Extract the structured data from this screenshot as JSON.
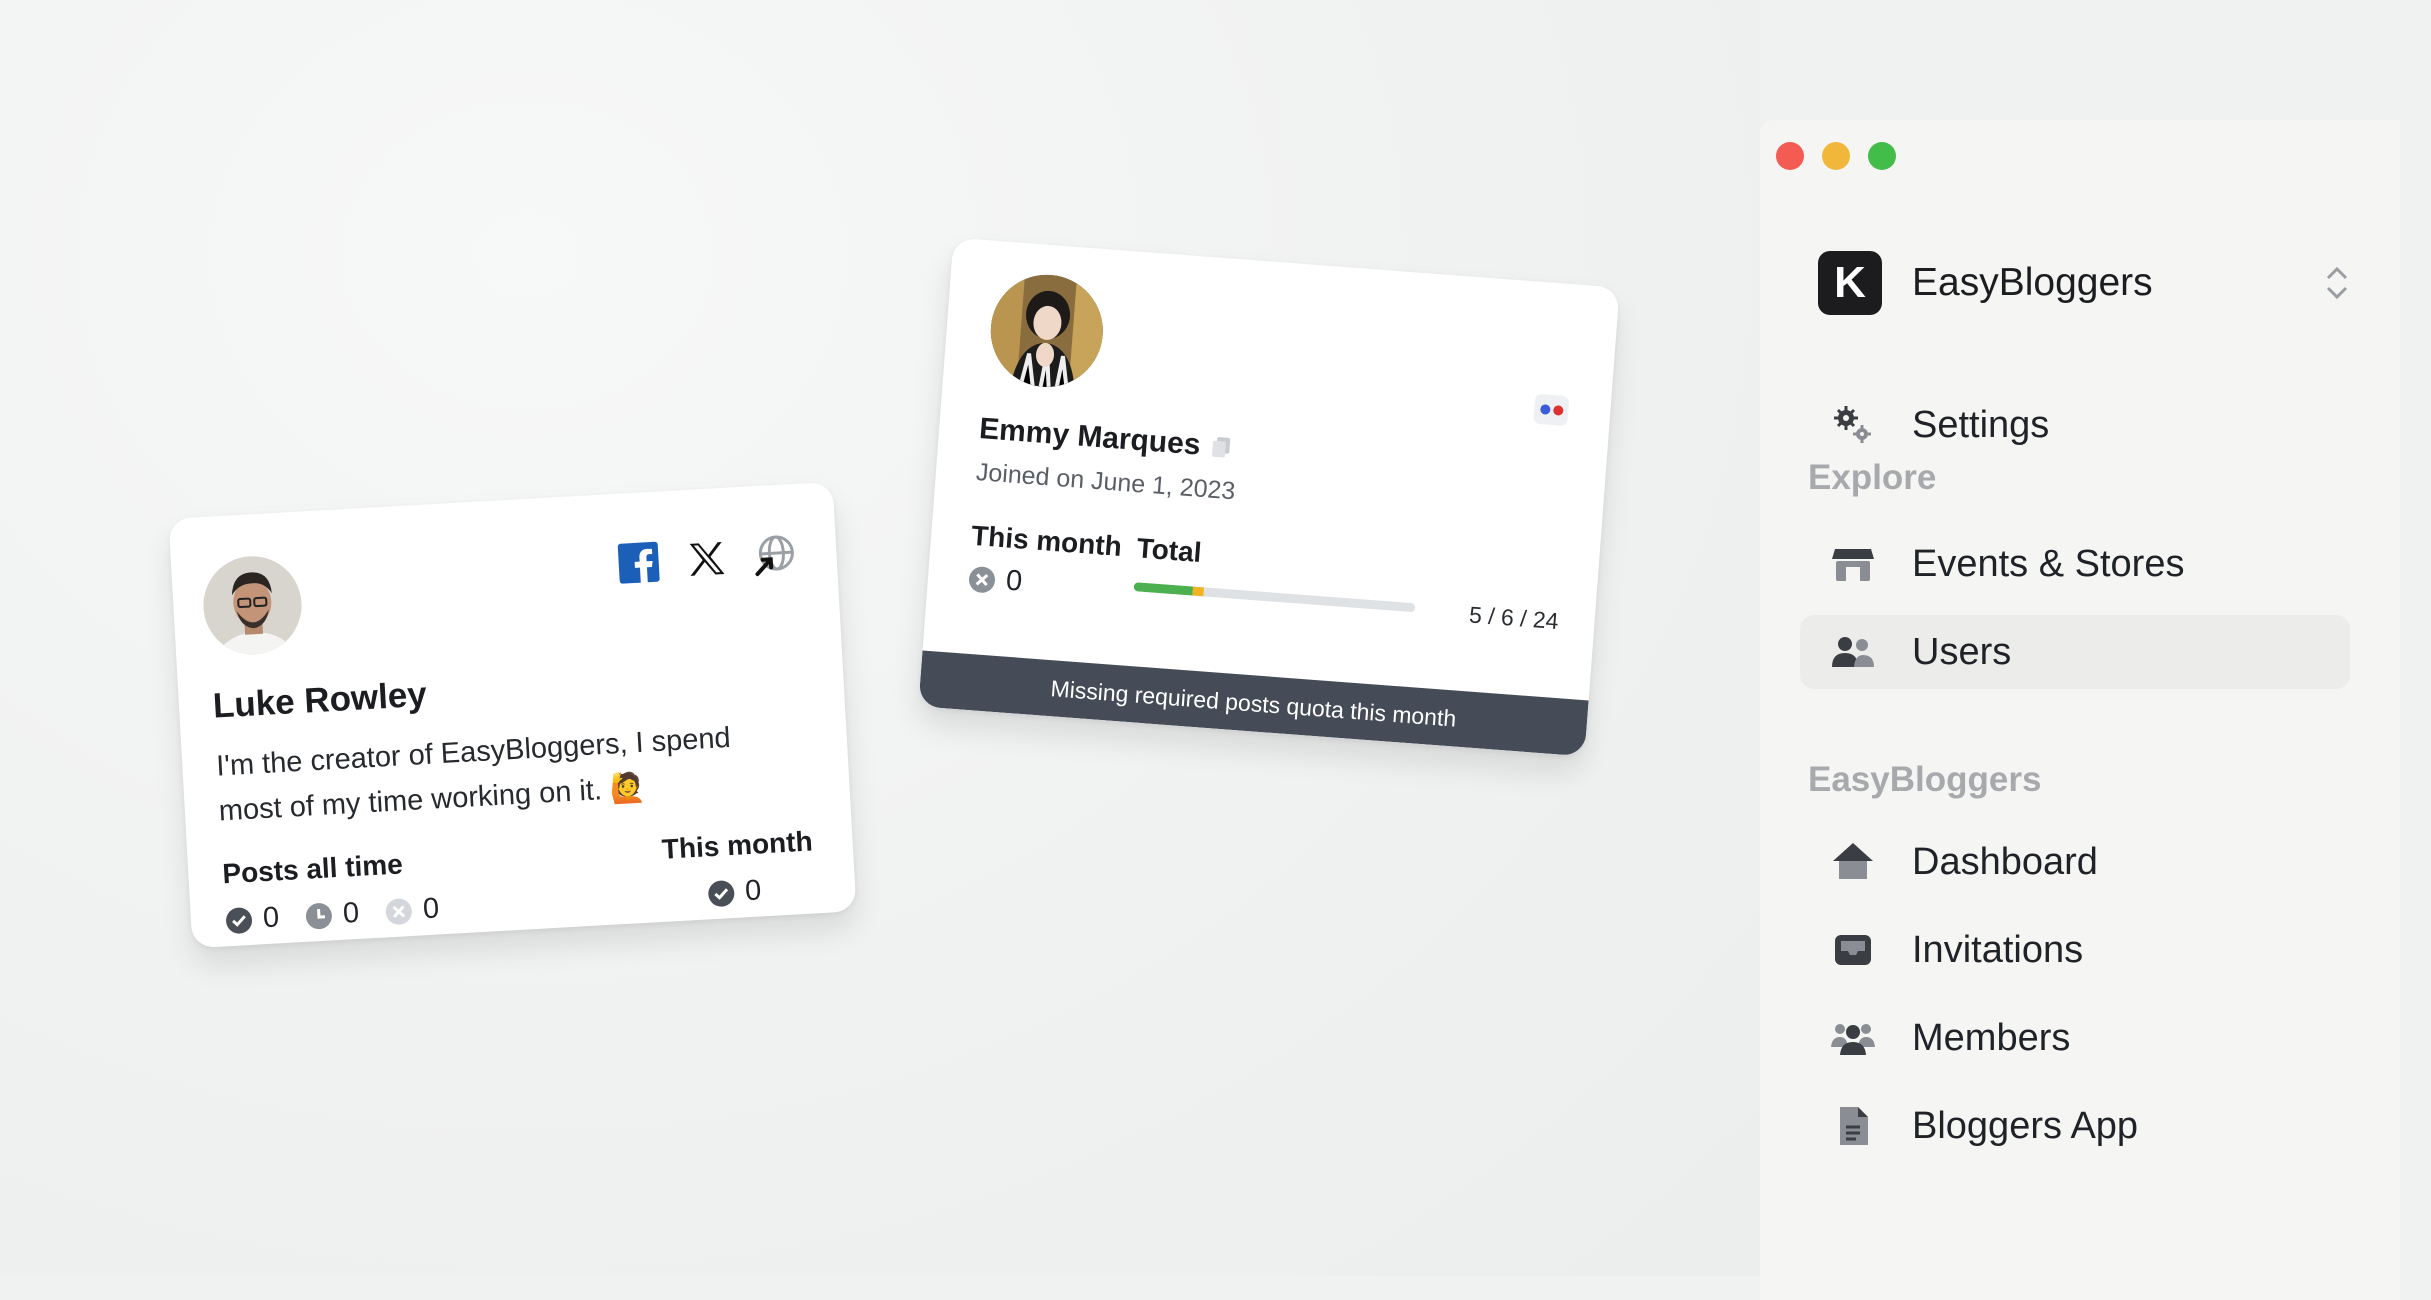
{
  "card_luke": {
    "name": "Luke Rowley",
    "bio": "I'm the creator of EasyBloggers, I spend most of my time working on it. 🙋",
    "posts_all_time_label": "Posts all time",
    "this_month_label": "This month",
    "posts_approved": "0",
    "posts_pending": "0",
    "posts_rejected": "0",
    "month_approved": "0",
    "socials": [
      "facebook-icon",
      "x-icon",
      "website-icon"
    ]
  },
  "card_emmy": {
    "name": "Emmy Marques",
    "joined": "Joined on June 1, 2023",
    "this_month_label": "This month",
    "total_label": "Total",
    "month_rejected": "0",
    "ratio": "5 / 6 / 24",
    "progress": {
      "approved": 0.21,
      "pending": 0.04
    },
    "footer": "Missing required posts quota this month",
    "flag_colors": [
      "#3b5bdb",
      "#e03131"
    ]
  },
  "window": {
    "traffic_lights": [
      "#f35b53",
      "#f1b73a",
      "#42bd4a"
    ]
  },
  "sidebar": {
    "logo_letter": "K",
    "workspace": "EasyBloggers",
    "settings": "Settings",
    "section_explore": "Explore",
    "events_stores": "Events & Stores",
    "users": "Users",
    "section_easybloggers": "EasyBloggers",
    "dashboard": "Dashboard",
    "invitations": "Invitations",
    "members": "Members",
    "bloggers_app": "Bloggers App"
  }
}
